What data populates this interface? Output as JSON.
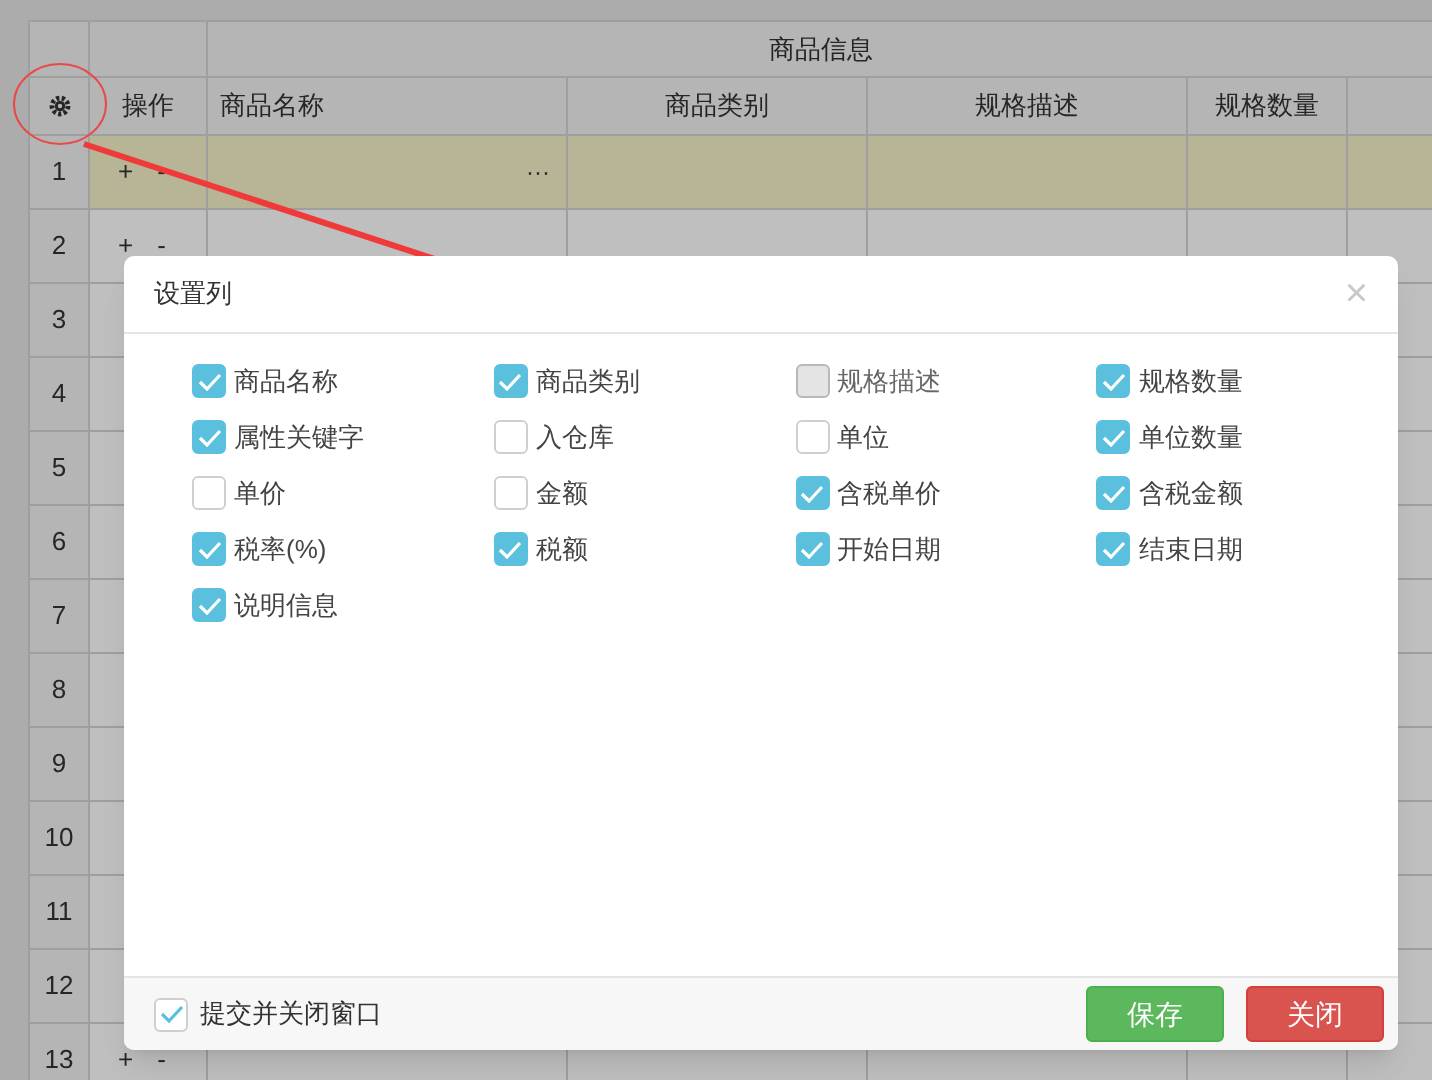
{
  "table": {
    "group_header": "商品信息",
    "columns": [
      "操作",
      "商品名称",
      "商品类别",
      "规格描述",
      "规格数量"
    ],
    "rows": [
      {
        "number": "1",
        "plus": "+",
        "minus": "-",
        "more": "···",
        "selected": true
      },
      {
        "number": "2",
        "plus": "+",
        "minus": "-",
        "selected": false
      },
      {
        "number": "3",
        "selected": false
      },
      {
        "number": "4",
        "selected": false
      },
      {
        "number": "5",
        "selected": false
      },
      {
        "number": "6",
        "selected": false
      },
      {
        "number": "7",
        "selected": false
      },
      {
        "number": "8",
        "selected": false
      },
      {
        "number": "9",
        "selected": false
      },
      {
        "number": "10",
        "selected": false
      },
      {
        "number": "11",
        "selected": false
      },
      {
        "number": "12",
        "selected": false
      },
      {
        "number": "13",
        "plus": "+",
        "minus": "-",
        "selected": false
      }
    ]
  },
  "dialog": {
    "title": "设置列",
    "close": "×",
    "options": [
      {
        "label": "商品名称",
        "checked": true,
        "disabled": false
      },
      {
        "label": "商品类别",
        "checked": true,
        "disabled": false
      },
      {
        "label": "规格描述",
        "checked": false,
        "disabled": true
      },
      {
        "label": "规格数量",
        "checked": true,
        "disabled": false
      },
      {
        "label": "属性关键字",
        "checked": true,
        "disabled": false
      },
      {
        "label": "入仓库",
        "checked": false,
        "disabled": false
      },
      {
        "label": "单位",
        "checked": false,
        "disabled": false
      },
      {
        "label": "单位数量",
        "checked": true,
        "disabled": false
      },
      {
        "label": "单价",
        "checked": false,
        "disabled": false
      },
      {
        "label": "金额",
        "checked": false,
        "disabled": false
      },
      {
        "label": "含税单价",
        "checked": true,
        "disabled": false
      },
      {
        "label": "含税金额",
        "checked": true,
        "disabled": false
      },
      {
        "label": "税率(%)",
        "checked": true,
        "disabled": false
      },
      {
        "label": "税额",
        "checked": true,
        "disabled": false
      },
      {
        "label": "开始日期",
        "checked": true,
        "disabled": false
      },
      {
        "label": "结束日期",
        "checked": true,
        "disabled": false
      },
      {
        "label": "说明信息",
        "checked": true,
        "disabled": false
      }
    ],
    "close_on_submit": {
      "label": "提交并关闭窗口",
      "checked": true
    },
    "buttons": [
      {
        "label": "保存",
        "kind": "primary"
      },
      {
        "label": "关闭",
        "kind": "danger"
      }
    ]
  }
}
